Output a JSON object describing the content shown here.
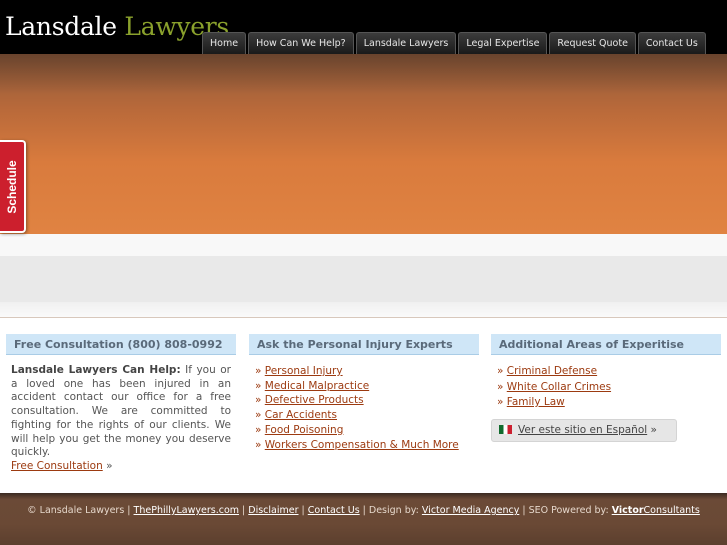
{
  "logo": {
    "part1": "Lansdale",
    "part2": "Lawyers"
  },
  "nav": [
    {
      "label": "Home"
    },
    {
      "label": "How Can We Help?"
    },
    {
      "label": "Lansdale Lawyers"
    },
    {
      "label": "Legal Expertise"
    },
    {
      "label": "Request Quote"
    },
    {
      "label": "Contact Us"
    }
  ],
  "schedule_tab": "Schedule",
  "col1": {
    "title": "Free Consultation (800) 808-0992",
    "lead": "Lansdale Lawyers Can Help:",
    "text": " If you or a loved one has been injured in an accident contact our office for a free consultation. We are committed to fighting for the rights of our clients. We will help you get the money you deserve quickly.",
    "link": "Free Consultation",
    "raquo": " »"
  },
  "col2": {
    "title": "Ask the Personal Injury Experts",
    "items": [
      "Personal Injury",
      "Medical Malpractice",
      "Defective Products",
      "Car Accidents",
      "Food Poisoning",
      "Workers Compensation & Much More"
    ]
  },
  "col3": {
    "title": "Additional Areas of Experitise",
    "items": [
      "Criminal Defense",
      "White Collar Crimes",
      "Family Law"
    ],
    "espanol": {
      "link": "Ver este sitio en Español",
      "raquo": " »",
      "flag_icon": "mexico-flag-icon"
    }
  },
  "raquo": "» ",
  "footer": {
    "copyright": "© Lansdale Lawyers | ",
    "link1": "ThePhillyLawyers.com",
    "sep1": " | ",
    "link2": "Disclaimer",
    "sep2": " | ",
    "link3": "Contact Us",
    "design_by": " | Design by: ",
    "link4": "Victor Media Agency",
    "seo": " | SEO Powered by: ",
    "link5_bold": "Victor",
    "link5_rest": "Consultants"
  },
  "colors": {
    "header_bg": "#000000",
    "logo_accent": "#8aa12c",
    "hero_orange": "#e08342",
    "column_header_bg": "#cfe6f7",
    "link": "#9c3a10",
    "schedule_red": "#cc1f2d",
    "footer_bg": "#6a4935"
  }
}
